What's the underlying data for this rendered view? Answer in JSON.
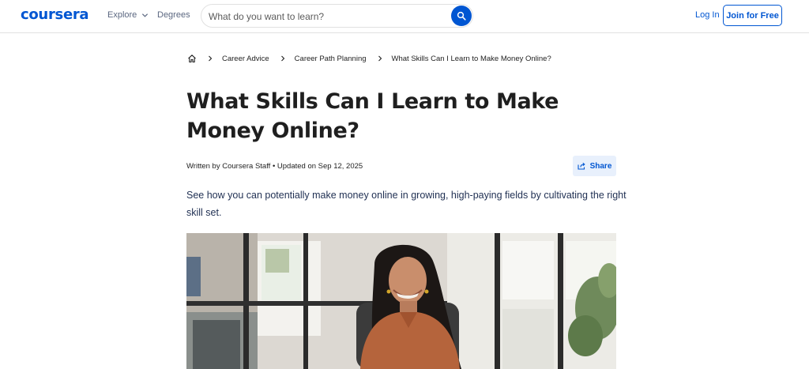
{
  "header": {
    "logo": "coursera",
    "explore_label": "Explore",
    "degrees_label": "Degrees",
    "search_placeholder": "What do you want to learn?",
    "login_label": "Log In",
    "join_label": "Join for Free"
  },
  "breadcrumb": {
    "items": [
      "Career Advice",
      "Career Path Planning",
      "What Skills Can I Learn to Make Money Online?"
    ]
  },
  "article": {
    "title": "What Skills Can I Learn to Make Money Online?",
    "byline": "Written by Coursera Staff • Updated on Sep 12, 2025",
    "share_label": "Share",
    "subtitle": "See how you can potentially make money online in growing, high-paying fields by cultivating the right skill set."
  },
  "colors": {
    "brand": "#0056d2",
    "share_bg": "#e8f0fc",
    "subtitle_text": "#1f2f52"
  },
  "icons": [
    "chevron-down-icon",
    "search-icon",
    "home-icon",
    "chevron-right-icon",
    "share-icon"
  ]
}
